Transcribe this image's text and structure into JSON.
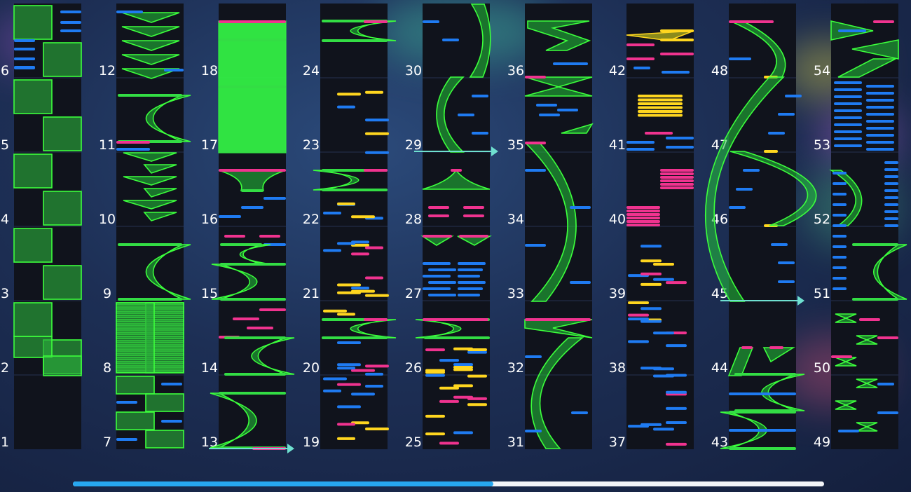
{
  "chart_data": {
    "type": "rhythm-game-note-chart",
    "measures_per_column": 6,
    "columns": [
      {
        "first_measure": 1,
        "last_measure": 6
      },
      {
        "first_measure": 7,
        "last_measure": 12
      },
      {
        "first_measure": 13,
        "last_measure": 18
      },
      {
        "first_measure": 19,
        "last_measure": 24
      },
      {
        "first_measure": 25,
        "last_measure": 30
      },
      {
        "first_measure": 31,
        "last_measure": 36
      },
      {
        "first_measure": 37,
        "last_measure": 42
      },
      {
        "first_measure": 43,
        "last_measure": 48
      },
      {
        "first_measure": 49,
        "last_measure": 54
      }
    ],
    "measure_labels": [
      "1",
      "2",
      "3",
      "4",
      "5",
      "6",
      "7",
      "8",
      "9",
      "10",
      "11",
      "12",
      "13",
      "14",
      "15",
      "16",
      "17",
      "18",
      "19",
      "20",
      "21",
      "22",
      "23",
      "24",
      "25",
      "26",
      "27",
      "28",
      "29",
      "30",
      "31",
      "32",
      "33",
      "34",
      "35",
      "36",
      "37",
      "38",
      "39",
      "40",
      "41",
      "42",
      "43",
      "44",
      "45",
      "46",
      "47",
      "48",
      "49",
      "50",
      "51",
      "52",
      "53",
      "54"
    ],
    "note_colors": {
      "tap": "#1f7bf2",
      "critical": "#ffd61f",
      "flick": "#f0338f",
      "hold": "#33dd44",
      "slide_marker": "#6fe0d0"
    }
  },
  "scrollbar": {
    "progress": 0.56,
    "thumb_color": "#27a7f0",
    "track_color": "#f2f4f8"
  }
}
